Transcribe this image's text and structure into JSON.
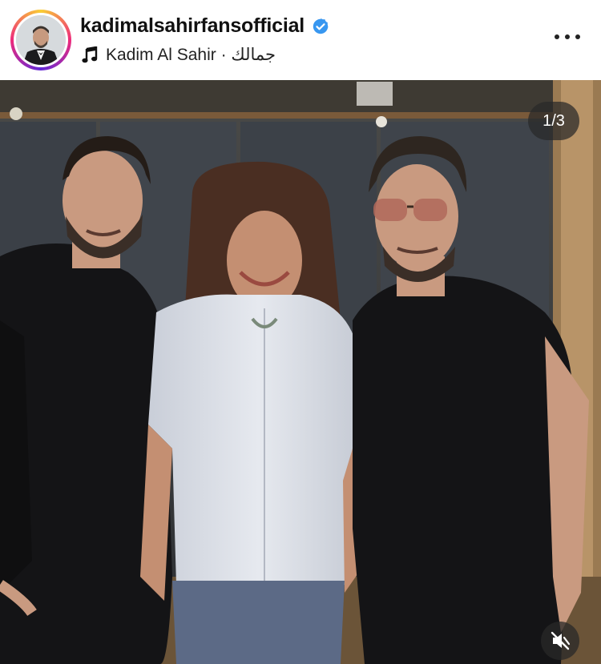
{
  "post": {
    "username": "kadimalsahirfansofficial",
    "audio": "Kadim Al Sahir · جمالك",
    "verified": true
  },
  "carousel": {
    "counter": "1/3"
  },
  "icons": {
    "verified": "verified-badge-icon",
    "music": "music-note-icon",
    "more": "more-options-icon",
    "mute": "speaker-muted-icon"
  },
  "colors": {
    "verified": "#3897f0",
    "text": "#111111"
  }
}
